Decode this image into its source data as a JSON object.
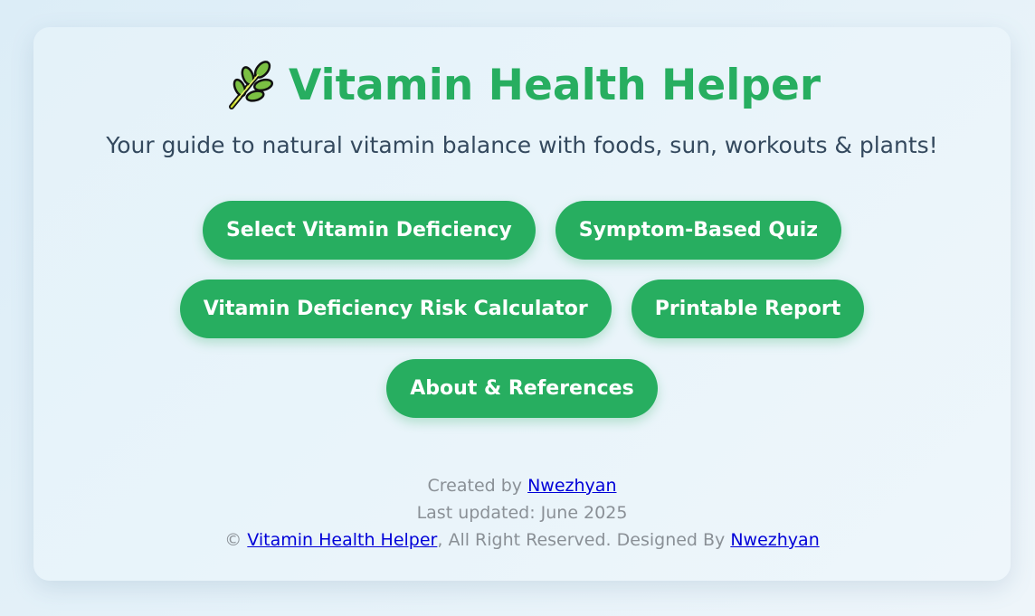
{
  "header": {
    "icon": "herb-leaf-icon",
    "title": "Vitamin Health Helper",
    "subtitle": "Your guide to natural vitamin balance with foods, sun, workouts & plants!"
  },
  "buttons": [
    {
      "label": "Select Vitamin Deficiency"
    },
    {
      "label": "Symptom-Based Quiz"
    },
    {
      "label": "Vitamin Deficiency Risk Calculator"
    },
    {
      "label": "Printable Report"
    },
    {
      "label": "About & References"
    }
  ],
  "footer": {
    "created_prefix": "Created by ",
    "created_author": "Nwezhyan",
    "last_updated": "Last updated: June 2025",
    "copyright_symbol": "© ",
    "site_link": "Vitamin Health Helper",
    "rights_text": ", All Right Reserved. Designed By ",
    "designer_link": "Nwezhyan"
  },
  "colors": {
    "accent": "#27ae60",
    "subtitle": "#34495e",
    "footer_text": "#8a9096",
    "link": "#0000d8"
  }
}
